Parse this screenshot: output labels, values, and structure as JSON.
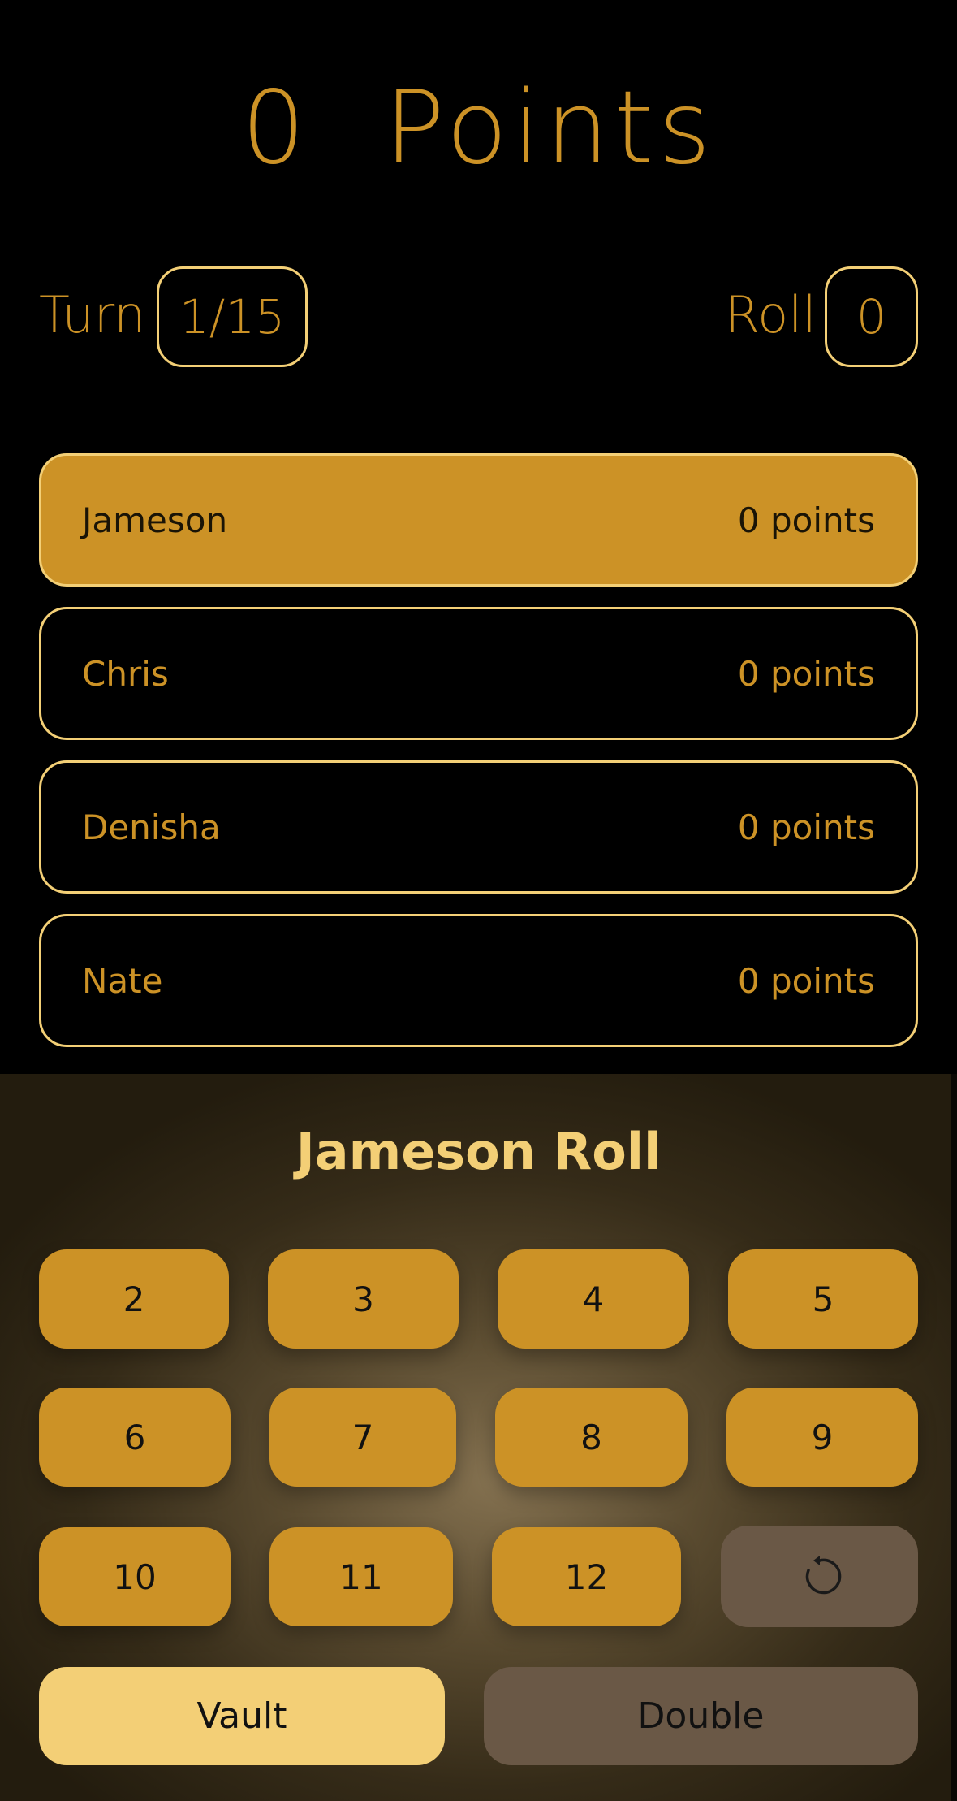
{
  "header": {
    "points_title": "0  Points",
    "turn_label": "Turn",
    "turn_value": "1/15",
    "roll_label": "Roll",
    "roll_value": "0"
  },
  "players": [
    {
      "name": "Jameson",
      "points": "0 points",
      "active": true
    },
    {
      "name": "Chris",
      "points": "0 points",
      "active": false
    },
    {
      "name": "Denisha",
      "points": "0 points",
      "active": false
    },
    {
      "name": "Nate",
      "points": "0 points",
      "active": false
    }
  ],
  "roll_panel": {
    "title": "Jameson Roll",
    "numbers": [
      "2",
      "3",
      "4",
      "5",
      "6",
      "7",
      "8",
      "9",
      "10",
      "11",
      "12"
    ],
    "reset_icon": "undo-icon",
    "vault_label": "Vault",
    "double_label": "Double"
  },
  "colors": {
    "accent": "#cc9226",
    "light_accent": "#f3cf76",
    "muted_button": "#6a5846",
    "background": "#000000"
  }
}
